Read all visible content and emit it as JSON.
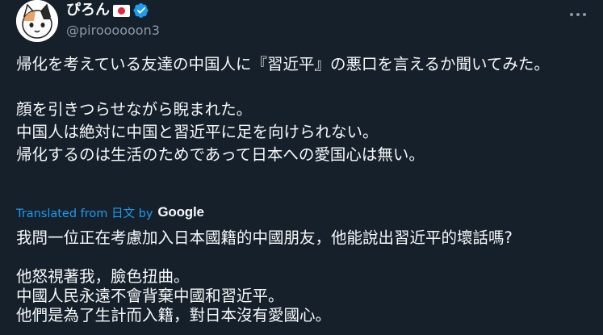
{
  "author": {
    "display_name": "ぴろん",
    "handle": "@piroooooon3"
  },
  "icons": {
    "flag": "japan-flag-icon",
    "verified": "verified-badge-icon",
    "more": "more-options-icon",
    "avatar": "calico-cat-avatar"
  },
  "colors": {
    "background": "#15202b",
    "link": "#1d9bf0",
    "verified": "#1d9bf0",
    "secondary_text": "#8b98a5"
  },
  "tweet": {
    "text": "帰化を考えている友達の中国人に『習近平』の悪口を言えるか聞いてみた。\n\n顔を引きつらせながら睨まれた。\n中国人は絶対に中国と習近平に足を向けられない。\n帰化するのは生活のためであって日本への愛国心は無い。"
  },
  "translation": {
    "label": "Translated from 日文 by",
    "provider": "Google",
    "text": "我問一位正在考慮加入日本國籍的中國朋友，他能說出習近平的壞話嗎?\n\n他怒視著我，臉色扭曲。\n中國人民永遠不會背棄中國和習近平。\n他們是為了生計而入籍，對日本沒有愛國心。"
  }
}
